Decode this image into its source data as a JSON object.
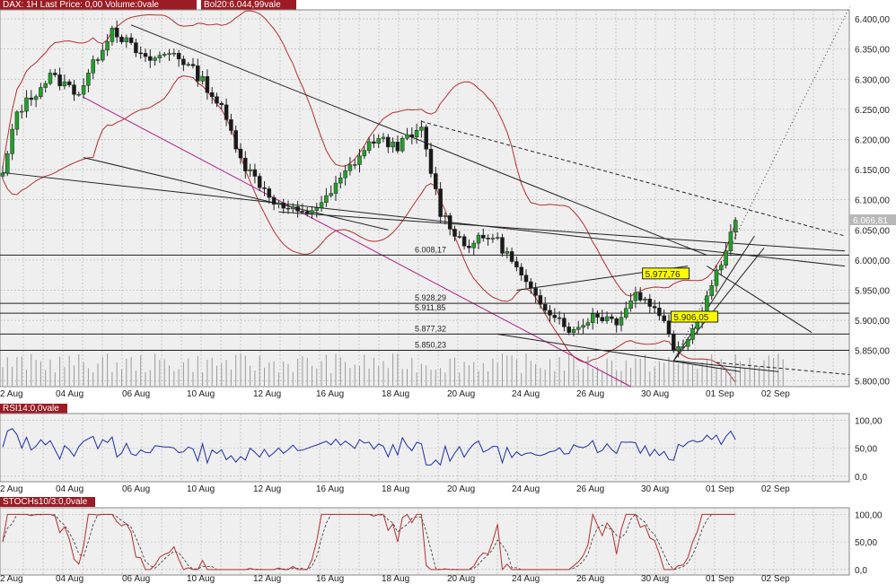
{
  "header": {
    "main_label": "DAX: 1H Last Price: 0,00 Volume:0vale",
    "bol_label": "Bol20:6.044,99vale",
    "rsi_label": "RSI14:0,0vale",
    "stoch_label": "STOCHs10/3:0,0vale"
  },
  "colors": {
    "panel_bg": "#efefef",
    "grid": "#b0b0b0",
    "bullish": "#22a02a",
    "bearish": "#1a1a1a",
    "bollinger": "#b43030",
    "rsi_line": "#1c2ea6",
    "stoch_k": "#b43030",
    "stoch_d": "#333333",
    "trend_purple": "#b0208c",
    "label_bg": "#ffff00",
    "tab_bg": "#9b1c24",
    "last_price_bg": "#b8b8b8"
  },
  "chart_data": [
    {
      "type": "candlestick",
      "name": "price-panel",
      "x_dates": [
        "2 Aug",
        "04 Aug",
        "06 Aug",
        "10 Aug",
        "12 Aug",
        "16 Aug",
        "18 Aug",
        "20 Aug",
        "24 Aug",
        "26 Aug",
        "30 Aug",
        "01 Sep",
        "02 Sep"
      ],
      "y_ticks": [
        5800,
        5850,
        5900,
        5950,
        6000,
        6050,
        6100,
        6150,
        6200,
        6250,
        6300,
        6350,
        6400
      ],
      "y_tick_labels": [
        "5.800,00",
        "5.850,00",
        "5.900,00",
        "5.950,00",
        "6.000,00",
        "6.050,00",
        "6.100,00",
        "6.150,00",
        "6.200,00",
        "6.250,00",
        "6.300,00",
        "6.350,00",
        "6.400,00"
      ],
      "ylim": [
        5790,
        6415
      ],
      "last_price": 6066.81,
      "last_price_label": "6.066,81",
      "horizontal_levels": [
        {
          "value": 6008.17,
          "label": "6.008,17"
        },
        {
          "value": 5928.29,
          "label": "5.928,29"
        },
        {
          "value": 5911.85,
          "label": "5.911,85"
        },
        {
          "value": 5877.32,
          "label": "5.877,32"
        },
        {
          "value": 5850.23,
          "label": "5.850,23"
        }
      ],
      "callouts": [
        {
          "value": 5977.76,
          "label": "5.977,76",
          "at_bar": 142
        },
        {
          "value": 5906.05,
          "label": "5.906,05",
          "at_bar": 148
        }
      ],
      "anchors": [
        {
          "bar": 0,
          "close": 6140
        },
        {
          "bar": 3,
          "close": 6245
        },
        {
          "bar": 10,
          "close": 6305
        },
        {
          "bar": 16,
          "close": 6278
        },
        {
          "bar": 23,
          "close": 6385
        },
        {
          "bar": 30,
          "close": 6330
        },
        {
          "bar": 36,
          "close": 6345
        },
        {
          "bar": 42,
          "close": 6298
        },
        {
          "bar": 46,
          "close": 6250
        },
        {
          "bar": 51,
          "close": 6155
        },
        {
          "bar": 58,
          "close": 6090
        },
        {
          "bar": 63,
          "close": 6075
        },
        {
          "bar": 68,
          "close": 6100
        },
        {
          "bar": 73,
          "close": 6155
        },
        {
          "bar": 78,
          "close": 6200
        },
        {
          "bar": 83,
          "close": 6190
        },
        {
          "bar": 88,
          "close": 6215
        },
        {
          "bar": 92,
          "close": 6080
        },
        {
          "bar": 97,
          "close": 6025
        },
        {
          "bar": 103,
          "close": 6040
        },
        {
          "bar": 106,
          "close": 6010
        },
        {
          "bar": 111,
          "close": 5945
        },
        {
          "bar": 116,
          "close": 5910
        },
        {
          "bar": 120,
          "close": 5880
        },
        {
          "bar": 124,
          "close": 5910
        },
        {
          "bar": 129,
          "close": 5900
        },
        {
          "bar": 133,
          "close": 5945
        },
        {
          "bar": 138,
          "close": 5915
        },
        {
          "bar": 141,
          "close": 5855
        },
        {
          "bar": 144,
          "close": 5870
        },
        {
          "bar": 148,
          "close": 5940
        },
        {
          "bar": 151,
          "close": 6000
        },
        {
          "bar": 154,
          "close": 6066
        }
      ]
    },
    {
      "type": "line",
      "name": "rsi-panel",
      "title": "RSI14:0,0vale",
      "y_ticks": [
        0,
        50,
        100
      ],
      "y_tick_labels": [
        "0,0",
        "50,00",
        "100,00"
      ],
      "ylim": [
        -10,
        112
      ],
      "x_dates": [
        "2 Aug",
        "04 Aug",
        "06 Aug",
        "10 Aug",
        "12 Aug",
        "16 Aug",
        "18 Aug",
        "20 Aug",
        "24 Aug",
        "26 Aug",
        "30 Aug",
        "01 Sep",
        "02 Sep"
      ]
    },
    {
      "type": "line",
      "name": "stoch-panel",
      "title": "STOCHs10/3:0,0vale",
      "y_ticks": [
        0,
        50,
        100
      ],
      "y_tick_labels": [
        "0,0",
        "50,00",
        "100,00"
      ],
      "ylim": [
        -10,
        112
      ],
      "x_dates": [
        "2 Aug",
        "04 Aug",
        "06 Aug",
        "10 Aug",
        "12 Aug",
        "16 Aug",
        "18 Aug",
        "20 Aug",
        "24 Aug",
        "26 Aug",
        "30 Aug",
        "01 Sep",
        "02 Sep"
      ]
    }
  ]
}
